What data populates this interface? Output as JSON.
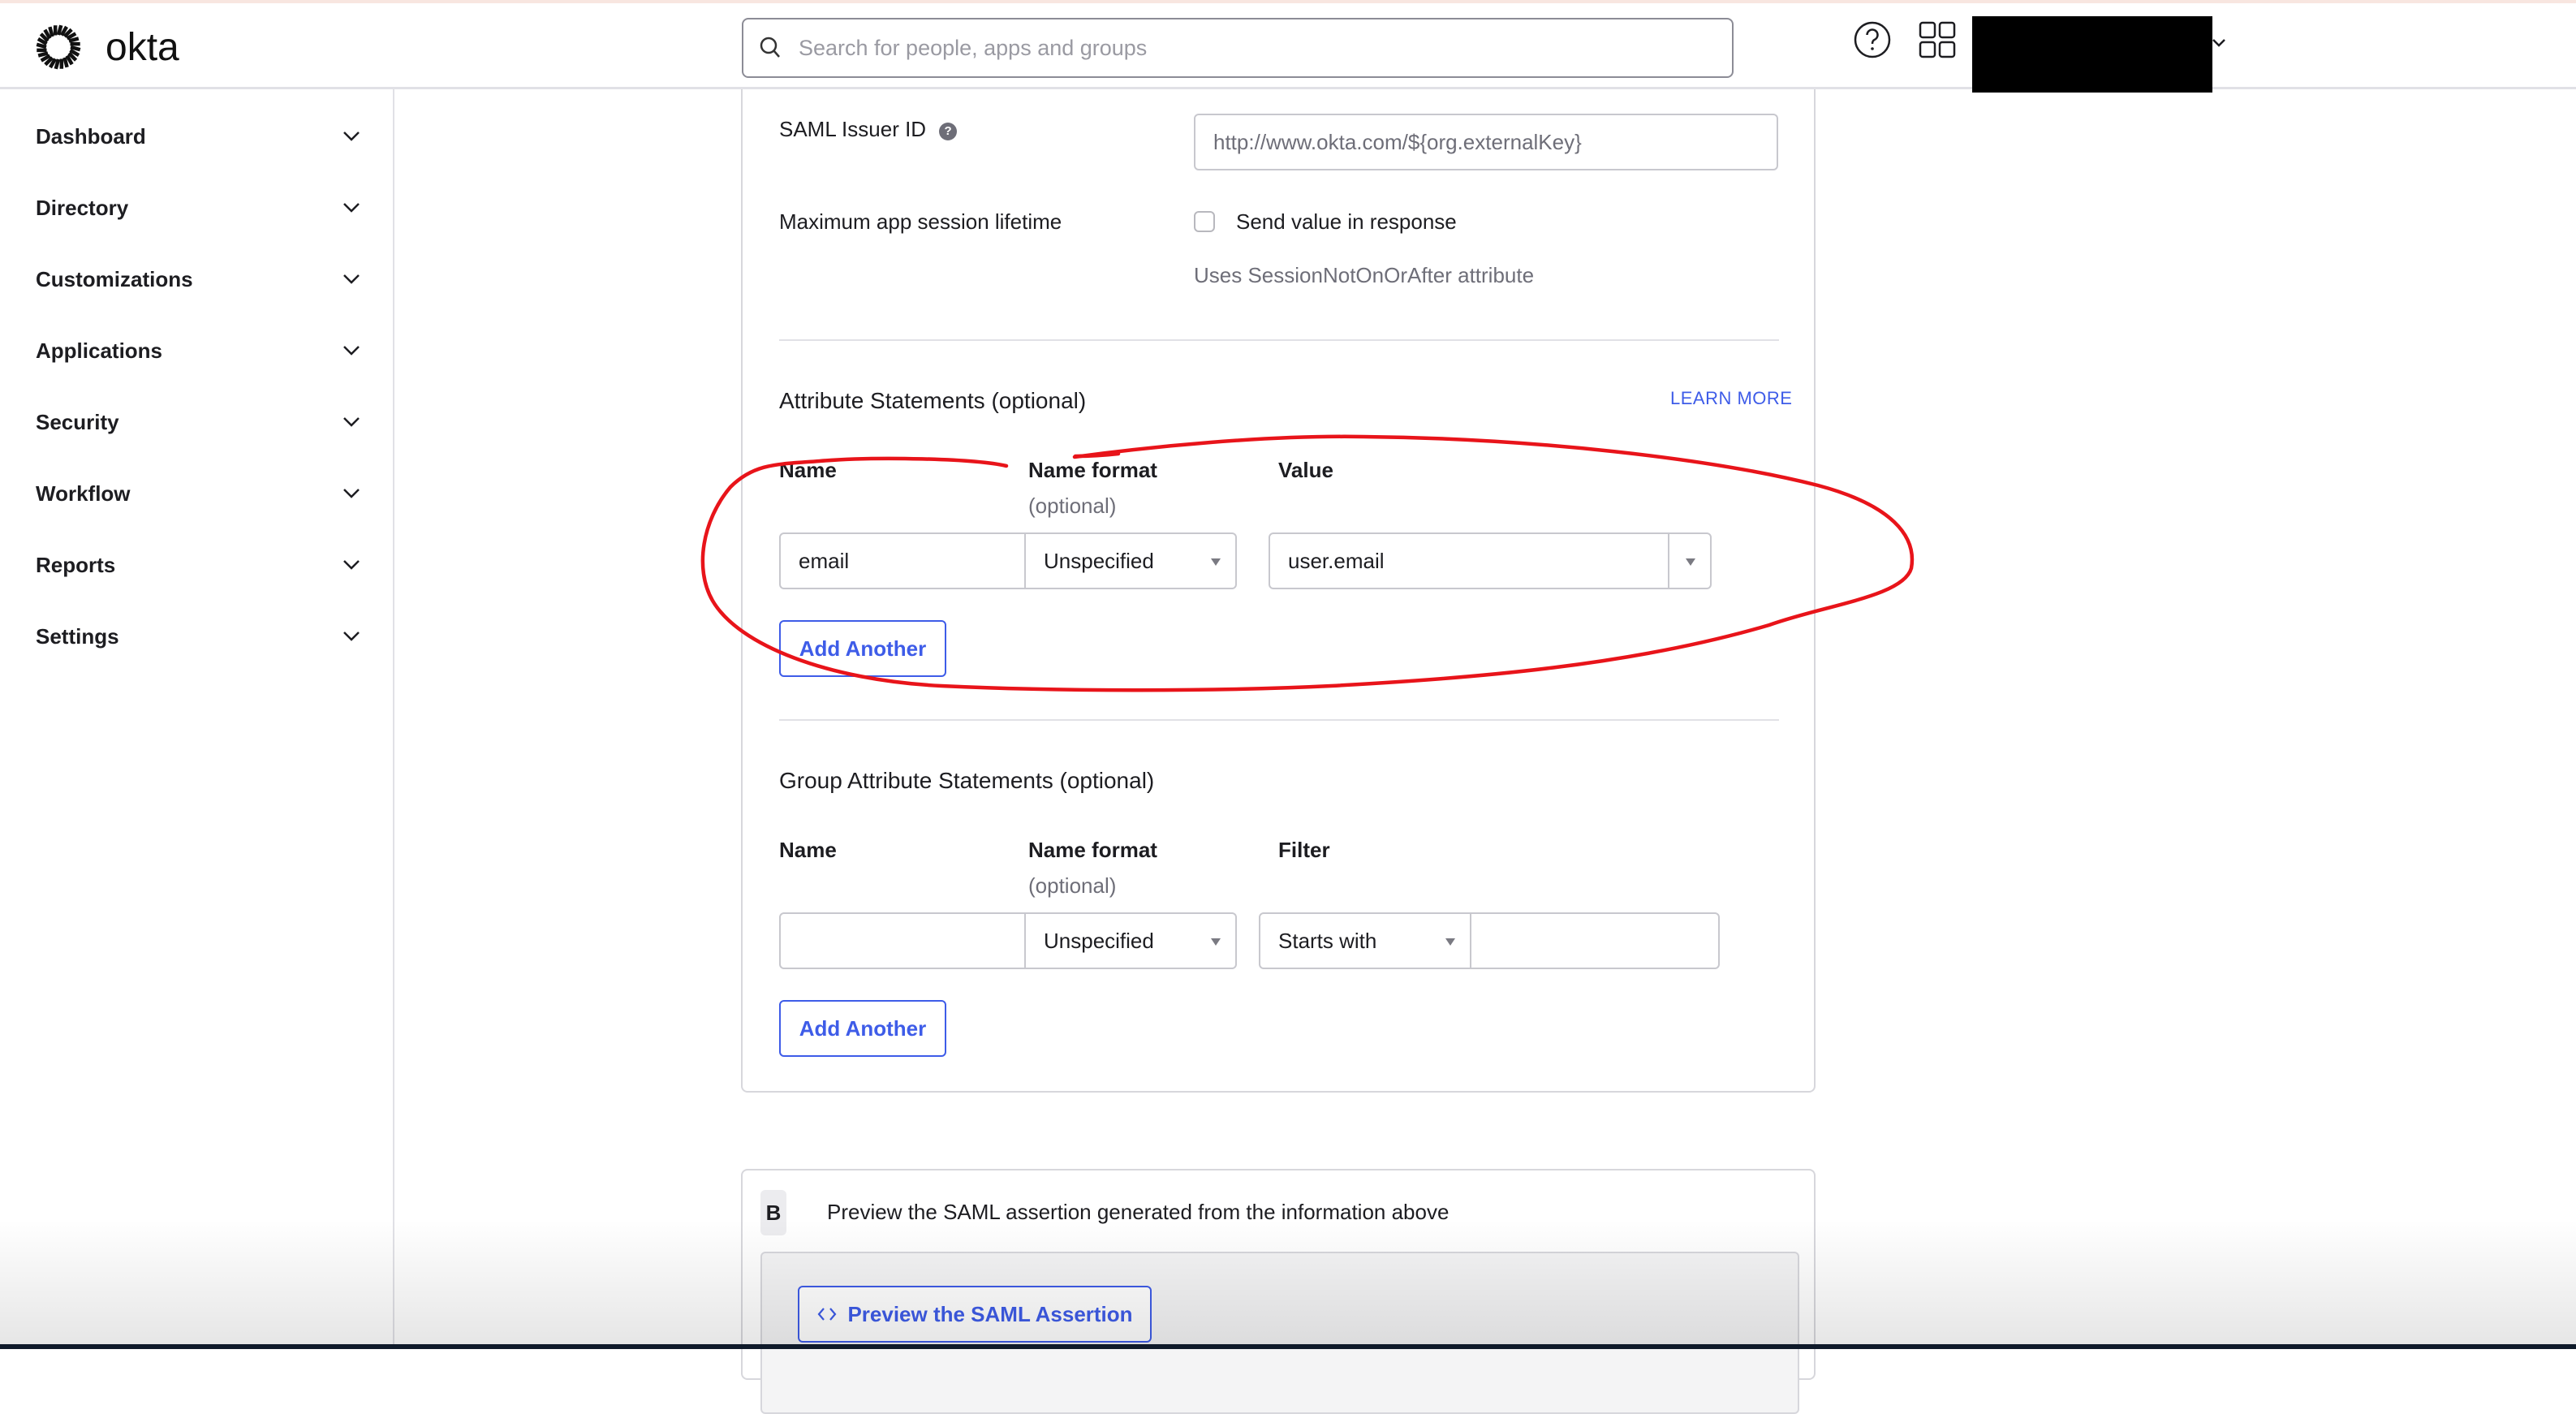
{
  "header": {
    "brand": "okta",
    "search_placeholder": "Search for people, apps and groups",
    "search_value": ""
  },
  "sidebar": {
    "items": [
      {
        "label": "Dashboard"
      },
      {
        "label": "Directory"
      },
      {
        "label": "Customizations"
      },
      {
        "label": "Applications"
      },
      {
        "label": "Security"
      },
      {
        "label": "Workflow"
      },
      {
        "label": "Reports"
      },
      {
        "label": "Settings"
      }
    ]
  },
  "saml": {
    "issuer_label": "SAML Issuer ID",
    "issuer_info": "?",
    "issuer_value": "http://www.okta.com/${org.externalKey}",
    "session_label": "Maximum app session lifetime",
    "session_checkbox_label": "Send value in response",
    "session_checked": false,
    "session_hint": "Uses SessionNotOnOrAfter attribute"
  },
  "attributes": {
    "title": "Attribute Statements (optional)",
    "learn_more": "LEARN MORE",
    "col_name": "Name",
    "col_format": "Name format",
    "col_format_sub": "(optional)",
    "col_value": "Value",
    "rows": [
      {
        "name": "email",
        "format": "Unspecified",
        "value": "user.email"
      }
    ],
    "add_button": "Add Another"
  },
  "group_attributes": {
    "title": "Group Attribute Statements (optional)",
    "col_name": "Name",
    "col_format": "Name format",
    "col_format_sub": "(optional)",
    "col_filter": "Filter",
    "rows": [
      {
        "name": "",
        "format": "Unspecified",
        "filter_type": "Starts with",
        "filter_value": ""
      }
    ],
    "add_button": "Add Another"
  },
  "preview": {
    "step": "B",
    "description": "Preview the SAML assertion generated from the information above",
    "button": "Preview the SAML Assertion"
  },
  "colors": {
    "accent": "#3e5ce8",
    "annotation": "#e8141a"
  }
}
